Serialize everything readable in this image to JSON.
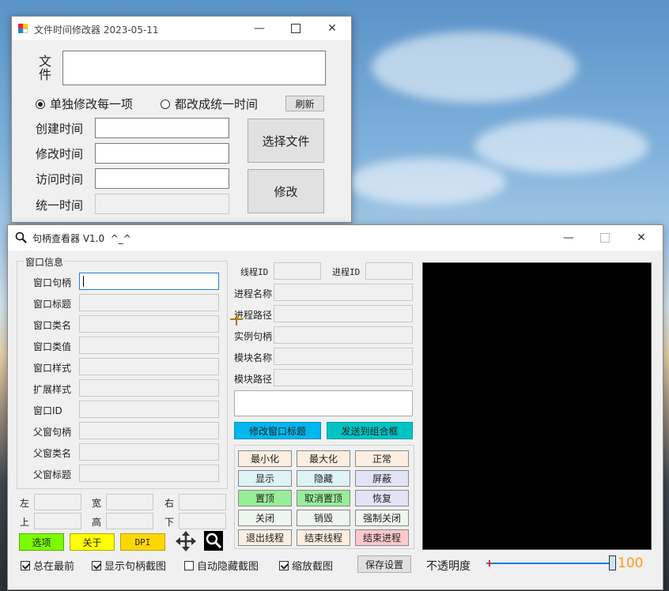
{
  "win1": {
    "title": "文件时间修改器 2023-05-11",
    "file_label": "文件",
    "file_value": "",
    "radio_each": "单独修改每一项",
    "radio_unified": "都改成统一时间",
    "refresh": "刷新",
    "rows": [
      {
        "label": "创建时间",
        "value": ""
      },
      {
        "label": "修改时间",
        "value": ""
      },
      {
        "label": "访问时间",
        "value": ""
      },
      {
        "label": "统一时间",
        "value": ""
      }
    ],
    "choose_file": "选择文件",
    "modify": "修改"
  },
  "win2": {
    "title": "句柄查看器 V1.0  ^_^",
    "group_label": "窗口信息",
    "left_fields": [
      {
        "label": "窗口句柄",
        "value": ""
      },
      {
        "label": "窗口标题",
        "value": ""
      },
      {
        "label": "窗口类名",
        "value": ""
      },
      {
        "label": "窗口类值",
        "value": ""
      },
      {
        "label": "窗口样式",
        "value": ""
      },
      {
        "label": "扩展样式",
        "value": ""
      },
      {
        "label": "窗口ID",
        "value": ""
      },
      {
        "label": "父窗句柄",
        "value": ""
      },
      {
        "label": "父窗类名",
        "value": ""
      },
      {
        "label": "父窗标题",
        "value": ""
      }
    ],
    "thread_id": "线程ID",
    "process_id": "进程ID",
    "right_fields": [
      {
        "label": "进程名称",
        "value": ""
      },
      {
        "label": "进程路径",
        "value": ""
      },
      {
        "label": "实例句柄",
        "value": ""
      },
      {
        "label": "模块名称",
        "value": ""
      },
      {
        "label": "模块路径",
        "value": ""
      }
    ],
    "modify_title": "修改窗口标题",
    "send_combo": "发送到组合框",
    "grid": [
      {
        "label": "最小化",
        "color": "#fbeee0"
      },
      {
        "label": "最大化",
        "color": "#fbeee0"
      },
      {
        "label": "正常",
        "color": "#fbeee0"
      },
      {
        "label": "显示",
        "color": "#ddf3f6"
      },
      {
        "label": "隐藏",
        "color": "#ddf3f6"
      },
      {
        "label": "屏蔽",
        "color": "#e3e3f7"
      },
      {
        "label": "置顶",
        "color": "#98ee98"
      },
      {
        "label": "取消置顶",
        "color": "#98ee98"
      },
      {
        "label": "恢复",
        "color": "#e3e3f7"
      },
      {
        "label": "关闭",
        "color": "#eef7ee"
      },
      {
        "label": "销毁",
        "color": "#eef7ee"
      },
      {
        "label": "强制关闭",
        "color": "#eef7ee"
      },
      {
        "label": "退出线程",
        "color": "#fbeee0"
      },
      {
        "label": "结束线程",
        "color": "#fbeee0"
      },
      {
        "label": "结束进程",
        "color": "#ffc8cc"
      }
    ],
    "pos": [
      {
        "label": "左",
        "value": ""
      },
      {
        "label": "宽",
        "value": ""
      },
      {
        "label": "右",
        "value": ""
      },
      {
        "label": "上",
        "value": ""
      },
      {
        "label": "高",
        "value": ""
      },
      {
        "label": "下",
        "value": ""
      }
    ],
    "btn_options": "选项",
    "btn_about": "关于",
    "btn_dpi": "DPI",
    "chk_topmost": "总在最前",
    "chk_show_capture": "显示句柄截图",
    "chk_auto_hide": "自动隐藏截图",
    "chk_scale": "缩放截图",
    "save_settings": "保存设置",
    "opacity_label": "不透明度",
    "opacity_value": "100",
    "opacity_fraction": 1.0
  },
  "colors": {
    "accent_blue": "#00b7ee",
    "accent_teal": "#00c4c4",
    "options_green": "#7cfc00",
    "about_yellow": "#ffff00",
    "dpi_gold": "#ffd700",
    "opacity_orange": "#ff9a1a"
  }
}
